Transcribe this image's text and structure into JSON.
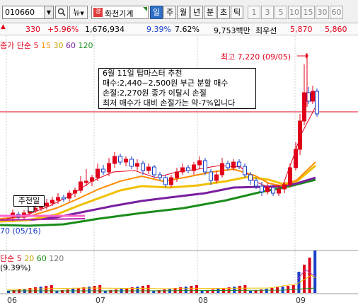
{
  "toolbar": {
    "code": "010660",
    "new_label": "뉴",
    "badge": "경",
    "name": "화천기계",
    "periods": [
      "일",
      "주",
      "월",
      "년",
      "분",
      "초",
      "틱"
    ],
    "active_period": "일",
    "numbers": [
      "1",
      "3",
      "5",
      "10",
      "15",
      "30",
      "60"
    ]
  },
  "quote": {
    "price": "330",
    "change_pct": "+5.96%",
    "volume": "1,676,934",
    "ratio1": "9.39%",
    "ratio2": "7.62%",
    "amount": "9,753백만",
    "min_label": "최우선",
    "bid": "5,870",
    "ask": "5,860"
  },
  "legend_top": {
    "prefix": "종가 단순",
    "p5": "5",
    "p15": "15",
    "p30": "30",
    "p60": "60",
    "p120": "120"
  },
  "legend_bottom": {
    "prefix": "단순",
    "p5": "5",
    "p20": "20",
    "p60": "60",
    "p120": "120"
  },
  "annotation": {
    "line1": "6월 11일 탑마스터 추천",
    "line2": "매수:2,440~2,500원 부근 분할 매수",
    "line3": "손절:2,270원 종가 이탈시 손절",
    "line4": "최저 매수가 대비 손절가는 약-7%입니다"
  },
  "max_label": "최고 7,220 (09/05)",
  "rec_label": "추천일",
  "low_label": "70 (05/16)",
  "vol_note": "(9.39%)",
  "x_labels": [
    "06",
    "07",
    "08",
    "09"
  ],
  "colors": {
    "up": "#e0001a",
    "down": "#1a3fc8",
    "ma5": "#e0001a",
    "ma15": "#ff8c00",
    "ma30": "#f0c000",
    "ma60": "#7a1fa0",
    "ma120": "#1a8c1a"
  },
  "chart_data": {
    "type": "candlestick",
    "x": [
      "06",
      "07",
      "08",
      "09"
    ],
    "ylim": [
      1500,
      7500
    ],
    "annotations": [
      "최고 7,220 (09/05)",
      "추천일",
      "70 (05/16)"
    ]
  }
}
